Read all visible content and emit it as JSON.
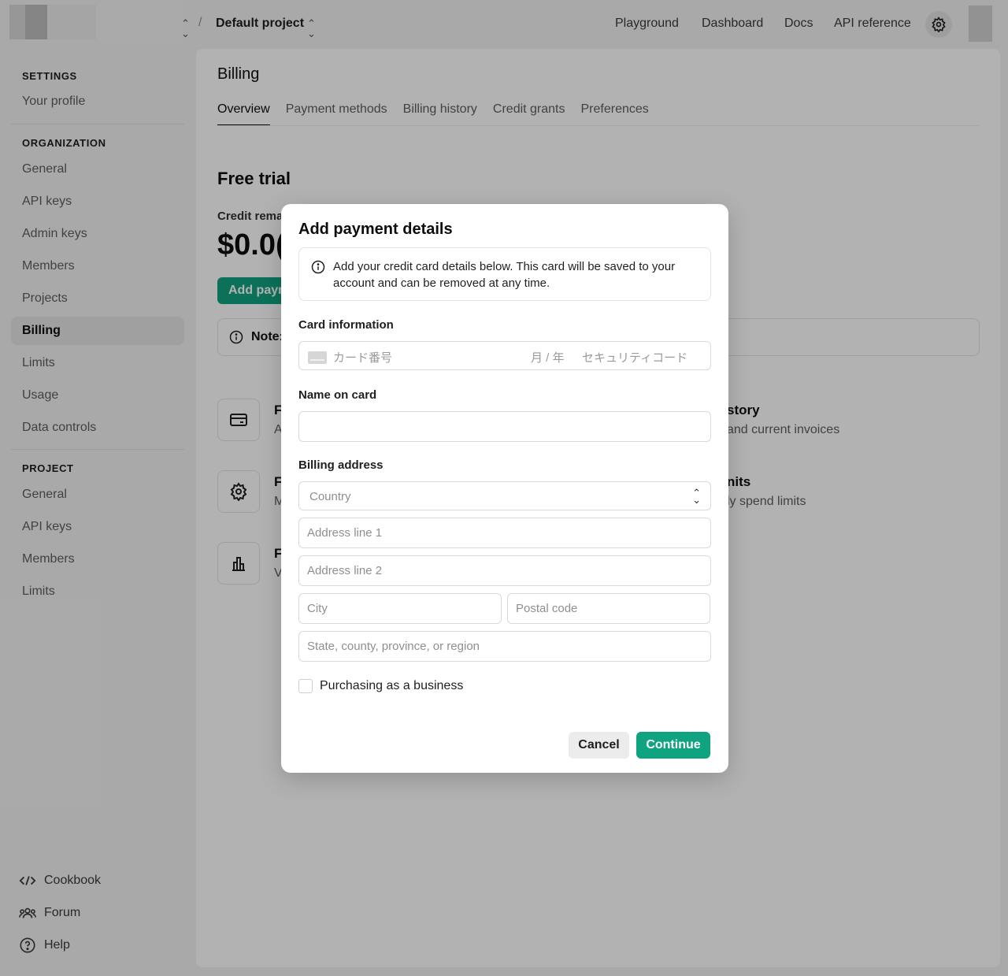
{
  "topbar": {
    "project": "Default project",
    "separator": "/",
    "links": [
      "Playground",
      "Dashboard",
      "Docs",
      "API reference"
    ]
  },
  "sidebar": {
    "settings_header": "SETTINGS",
    "your_profile": "Your profile",
    "org_header": "ORGANIZATION",
    "org_items": [
      "General",
      "API keys",
      "Admin keys",
      "Members",
      "Projects",
      "Billing",
      "Limits",
      "Usage",
      "Data controls"
    ],
    "project_header": "PROJECT",
    "project_items": [
      "General",
      "API keys",
      "Members",
      "Limits"
    ],
    "footer": [
      "Cookbook",
      "Forum",
      "Help"
    ]
  },
  "main": {
    "title": "Billing",
    "tabs": [
      "Overview",
      "Payment methods",
      "Billing history",
      "Credit grants",
      "Preferences"
    ],
    "section_title": "Free trial",
    "credit_label": "Credit rema",
    "credit_value": "$0.0(",
    "add_payment": "Add paym",
    "note": "Note:",
    "cards": [
      {
        "title": "F",
        "desc": "A",
        "right_title": "story",
        "right_desc": "and current invoices"
      },
      {
        "title": "F",
        "desc": "M",
        "right_title": "nits",
        "right_desc": "ly spend limits"
      },
      {
        "title": "F",
        "desc": "V"
      }
    ]
  },
  "modal": {
    "title": "Add payment details",
    "info": "Add your credit card details below. This card will be saved to your account and can be removed at any time.",
    "card_label": "Card information",
    "card_number_placeholder": "カード番号",
    "expiry_placeholder": "月 / 年",
    "cvc_placeholder": "セキュリティコード",
    "name_label": "Name on card",
    "name_value": "",
    "billing_label": "Billing address",
    "country_placeholder": "Country",
    "address1_placeholder": "Address line 1",
    "address2_placeholder": "Address line 2",
    "city_placeholder": "City",
    "postal_placeholder": "Postal code",
    "region_placeholder": "State, county, province, or region",
    "business_label": "Purchasing as a business",
    "cancel": "Cancel",
    "continue": "Continue"
  },
  "colors": {
    "accent": "#10a37f",
    "overlay": "rgba(0,0,0,0.30)"
  }
}
